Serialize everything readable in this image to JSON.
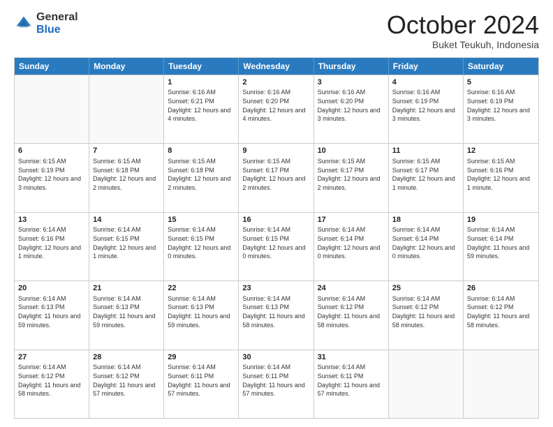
{
  "header": {
    "logo_general": "General",
    "logo_blue": "Blue",
    "month_title": "October 2024",
    "location": "Buket Teukuh, Indonesia"
  },
  "calendar": {
    "days_of_week": [
      "Sunday",
      "Monday",
      "Tuesday",
      "Wednesday",
      "Thursday",
      "Friday",
      "Saturday"
    ],
    "rows": [
      [
        {
          "day": "",
          "info": "",
          "empty": true
        },
        {
          "day": "",
          "info": "",
          "empty": true
        },
        {
          "day": "1",
          "info": "Sunrise: 6:16 AM\nSunset: 6:21 PM\nDaylight: 12 hours and 4 minutes."
        },
        {
          "day": "2",
          "info": "Sunrise: 6:16 AM\nSunset: 6:20 PM\nDaylight: 12 hours and 4 minutes."
        },
        {
          "day": "3",
          "info": "Sunrise: 6:16 AM\nSunset: 6:20 PM\nDaylight: 12 hours and 3 minutes."
        },
        {
          "day": "4",
          "info": "Sunrise: 6:16 AM\nSunset: 6:19 PM\nDaylight: 12 hours and 3 minutes."
        },
        {
          "day": "5",
          "info": "Sunrise: 6:16 AM\nSunset: 6:19 PM\nDaylight: 12 hours and 3 minutes."
        }
      ],
      [
        {
          "day": "6",
          "info": "Sunrise: 6:15 AM\nSunset: 6:19 PM\nDaylight: 12 hours and 3 minutes."
        },
        {
          "day": "7",
          "info": "Sunrise: 6:15 AM\nSunset: 6:18 PM\nDaylight: 12 hours and 2 minutes."
        },
        {
          "day": "8",
          "info": "Sunrise: 6:15 AM\nSunset: 6:18 PM\nDaylight: 12 hours and 2 minutes."
        },
        {
          "day": "9",
          "info": "Sunrise: 6:15 AM\nSunset: 6:17 PM\nDaylight: 12 hours and 2 minutes."
        },
        {
          "day": "10",
          "info": "Sunrise: 6:15 AM\nSunset: 6:17 PM\nDaylight: 12 hours and 2 minutes."
        },
        {
          "day": "11",
          "info": "Sunrise: 6:15 AM\nSunset: 6:17 PM\nDaylight: 12 hours and 1 minute."
        },
        {
          "day": "12",
          "info": "Sunrise: 6:15 AM\nSunset: 6:16 PM\nDaylight: 12 hours and 1 minute."
        }
      ],
      [
        {
          "day": "13",
          "info": "Sunrise: 6:14 AM\nSunset: 6:16 PM\nDaylight: 12 hours and 1 minute."
        },
        {
          "day": "14",
          "info": "Sunrise: 6:14 AM\nSunset: 6:15 PM\nDaylight: 12 hours and 1 minute."
        },
        {
          "day": "15",
          "info": "Sunrise: 6:14 AM\nSunset: 6:15 PM\nDaylight: 12 hours and 0 minutes."
        },
        {
          "day": "16",
          "info": "Sunrise: 6:14 AM\nSunset: 6:15 PM\nDaylight: 12 hours and 0 minutes."
        },
        {
          "day": "17",
          "info": "Sunrise: 6:14 AM\nSunset: 6:14 PM\nDaylight: 12 hours and 0 minutes."
        },
        {
          "day": "18",
          "info": "Sunrise: 6:14 AM\nSunset: 6:14 PM\nDaylight: 12 hours and 0 minutes."
        },
        {
          "day": "19",
          "info": "Sunrise: 6:14 AM\nSunset: 6:14 PM\nDaylight: 11 hours and 59 minutes."
        }
      ],
      [
        {
          "day": "20",
          "info": "Sunrise: 6:14 AM\nSunset: 6:13 PM\nDaylight: 11 hours and 59 minutes."
        },
        {
          "day": "21",
          "info": "Sunrise: 6:14 AM\nSunset: 6:13 PM\nDaylight: 11 hours and 59 minutes."
        },
        {
          "day": "22",
          "info": "Sunrise: 6:14 AM\nSunset: 6:13 PM\nDaylight: 11 hours and 59 minutes."
        },
        {
          "day": "23",
          "info": "Sunrise: 6:14 AM\nSunset: 6:13 PM\nDaylight: 11 hours and 58 minutes."
        },
        {
          "day": "24",
          "info": "Sunrise: 6:14 AM\nSunset: 6:12 PM\nDaylight: 11 hours and 58 minutes."
        },
        {
          "day": "25",
          "info": "Sunrise: 6:14 AM\nSunset: 6:12 PM\nDaylight: 11 hours and 58 minutes."
        },
        {
          "day": "26",
          "info": "Sunrise: 6:14 AM\nSunset: 6:12 PM\nDaylight: 11 hours and 58 minutes."
        }
      ],
      [
        {
          "day": "27",
          "info": "Sunrise: 6:14 AM\nSunset: 6:12 PM\nDaylight: 11 hours and 58 minutes."
        },
        {
          "day": "28",
          "info": "Sunrise: 6:14 AM\nSunset: 6:12 PM\nDaylight: 11 hours and 57 minutes."
        },
        {
          "day": "29",
          "info": "Sunrise: 6:14 AM\nSunset: 6:11 PM\nDaylight: 11 hours and 57 minutes."
        },
        {
          "day": "30",
          "info": "Sunrise: 6:14 AM\nSunset: 6:11 PM\nDaylight: 11 hours and 57 minutes."
        },
        {
          "day": "31",
          "info": "Sunrise: 6:14 AM\nSunset: 6:11 PM\nDaylight: 11 hours and 57 minutes."
        },
        {
          "day": "",
          "info": "",
          "empty": true
        },
        {
          "day": "",
          "info": "",
          "empty": true
        }
      ]
    ]
  }
}
